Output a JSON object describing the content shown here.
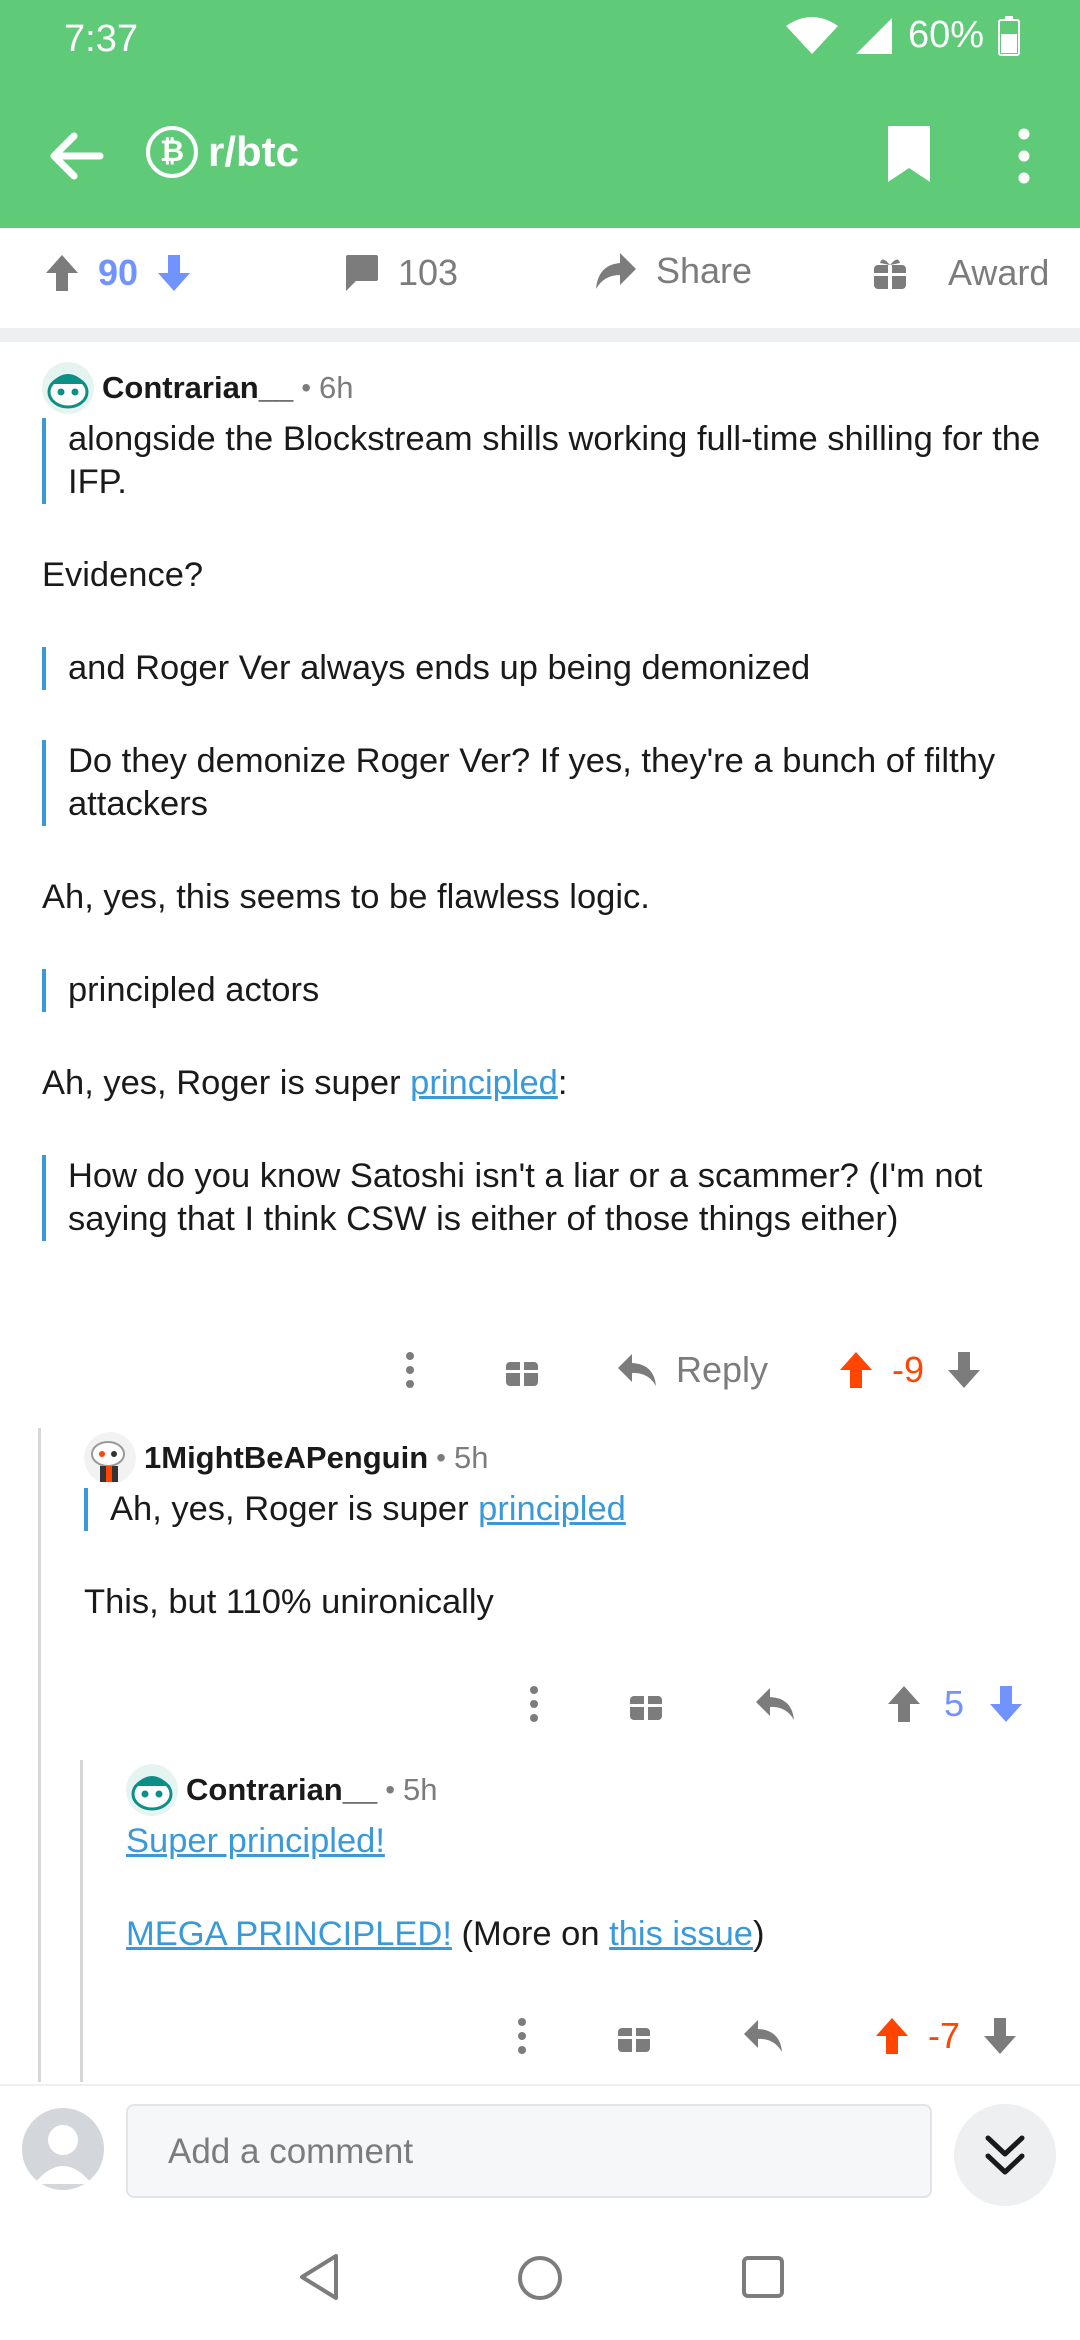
{
  "status": {
    "time": "7:37",
    "battery": "60%"
  },
  "header": {
    "subreddit": "r/btc",
    "sub_icon_glyph": "₿"
  },
  "post_actions": {
    "score": "90",
    "comments": "103",
    "share": "Share",
    "award": "Award"
  },
  "comments": [
    {
      "user": "Contrarian__",
      "time": "6h",
      "body": {
        "q1": "alongside the Blockstream shills working full-time shilling for the IFP.",
        "p1": "Evidence?",
        "q2": "and Roger Ver always ends up being demonized",
        "q3": "Do they demonize Roger Ver? If yes, they're a bunch of filthy attackers",
        "p2": "Ah, yes, this seems to be flawless logic.",
        "q4": "principled actors",
        "p3_pre": "Ah, yes, Roger is super ",
        "p3_link": "principled",
        "p3_post": ":",
        "q5": "How do you know Satoshi isn't a liar or a scammer? (I'm not saying that I think CSW is either of those things either)"
      },
      "reply_label": "Reply",
      "score": "-9"
    },
    {
      "user": "1MightBeAPenguin",
      "time": "5h",
      "body": {
        "q1_pre": "Ah, yes, Roger is super ",
        "q1_link": "principled",
        "p1": "This, but 110% unironically"
      },
      "score": "5"
    },
    {
      "user": "Contrarian__",
      "time": "5h",
      "body": {
        "link1": "Super principled!",
        "link2": "MEGA PRINCIPLED!",
        "mid": " (More on ",
        "link3": "this issue",
        "end": ")"
      },
      "score": "-7"
    }
  ],
  "composer": {
    "placeholder": "Add a comment"
  },
  "colors": {
    "brand": "#5fcb78",
    "link": "#3a9ad9",
    "upvote": "#ff4500",
    "downvote": "#7193ff"
  }
}
